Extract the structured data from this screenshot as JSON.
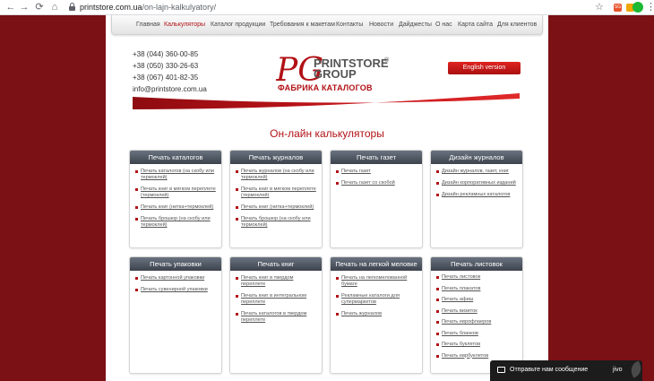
{
  "browser": {
    "back": "←",
    "forward": "→",
    "reload": "⟳",
    "home": "⌂",
    "url_domain": "printstore.com.ua",
    "url_path": "/on-lajn-kalkulyatory/",
    "star": "☆",
    "ext_badge": "SG",
    "menu": "⋮"
  },
  "nav": {
    "items": [
      "Главная",
      "Калькуляторы",
      "Каталог продукции",
      "Требования к макетам",
      "Контакты",
      "Новости",
      "Дайджесты",
      "О нас",
      "Карта сайта",
      "Для клиентов"
    ]
  },
  "header": {
    "phones": [
      "+38 (044) 360-00-85",
      "+38 (050) 330-26-63",
      "+38 (067) 401-82-35",
      "info@printstore.com.ua"
    ],
    "logo_monogram": "PG",
    "logo_line1": "PRINTSTORE",
    "logo_line2": "GROUP",
    "logo_reg": "®",
    "logo_slogan": "ФАБРИКА КАТАЛОГОВ",
    "english_label": "English version"
  },
  "page_title": "Он-лайн калькуляторы",
  "cards": [
    {
      "title": "Печать каталогов",
      "items": [
        "Печать каталогов (на скобу или термоклей)",
        "Печать книг в мягком переплете (термоклей)",
        "Печать книг (нитка+термоклей)",
        "Печать брошюр (на скобу или термоклей)"
      ]
    },
    {
      "title": "Печать журналов",
      "items": [
        "Печать журналов (на скобу или термоклей)",
        "Печать книг в мягком переплете (термоклей)",
        "Печать книг (нитка+термоклей)",
        "Печать брошюр (на скобу или термоклей)"
      ]
    },
    {
      "title": "Печать газет",
      "items": [
        "Печать газет",
        "Печать газет со скобой"
      ]
    },
    {
      "title": "Дизайн журналов",
      "items": [
        "Дизайн журналов, газет, книг",
        "Дизайн корпоративных изданий",
        "Дизайн рекламных каталогов"
      ]
    },
    {
      "title": "Печать упаковки",
      "items": [
        "Печать картонной упаковки",
        "Печать сувенирной упаковки"
      ]
    },
    {
      "title": "Печать книг",
      "items": [
        "Печать книг в твердом переплете",
        "Печать книг в интегральном переплете",
        "Печать каталогов в твердом переплете"
      ]
    },
    {
      "title": "Печать на легкой меловке",
      "items": [
        "Печать на легкомелованной бумаге",
        "Рекламные каталоги для супермаркетов",
        "Печать журналов"
      ]
    },
    {
      "title": "Печать листовок",
      "items": [
        "Печать листовок",
        "Печать плакатов",
        "Печать афиш",
        "Печать визиток",
        "Печать еврофлаеров",
        "Печать бланков",
        "Печать буклетов",
        "Печать еврбуклетов"
      ]
    }
  ],
  "chat": {
    "text": "Отправьте нам сообщение",
    "brand": "jivo"
  }
}
